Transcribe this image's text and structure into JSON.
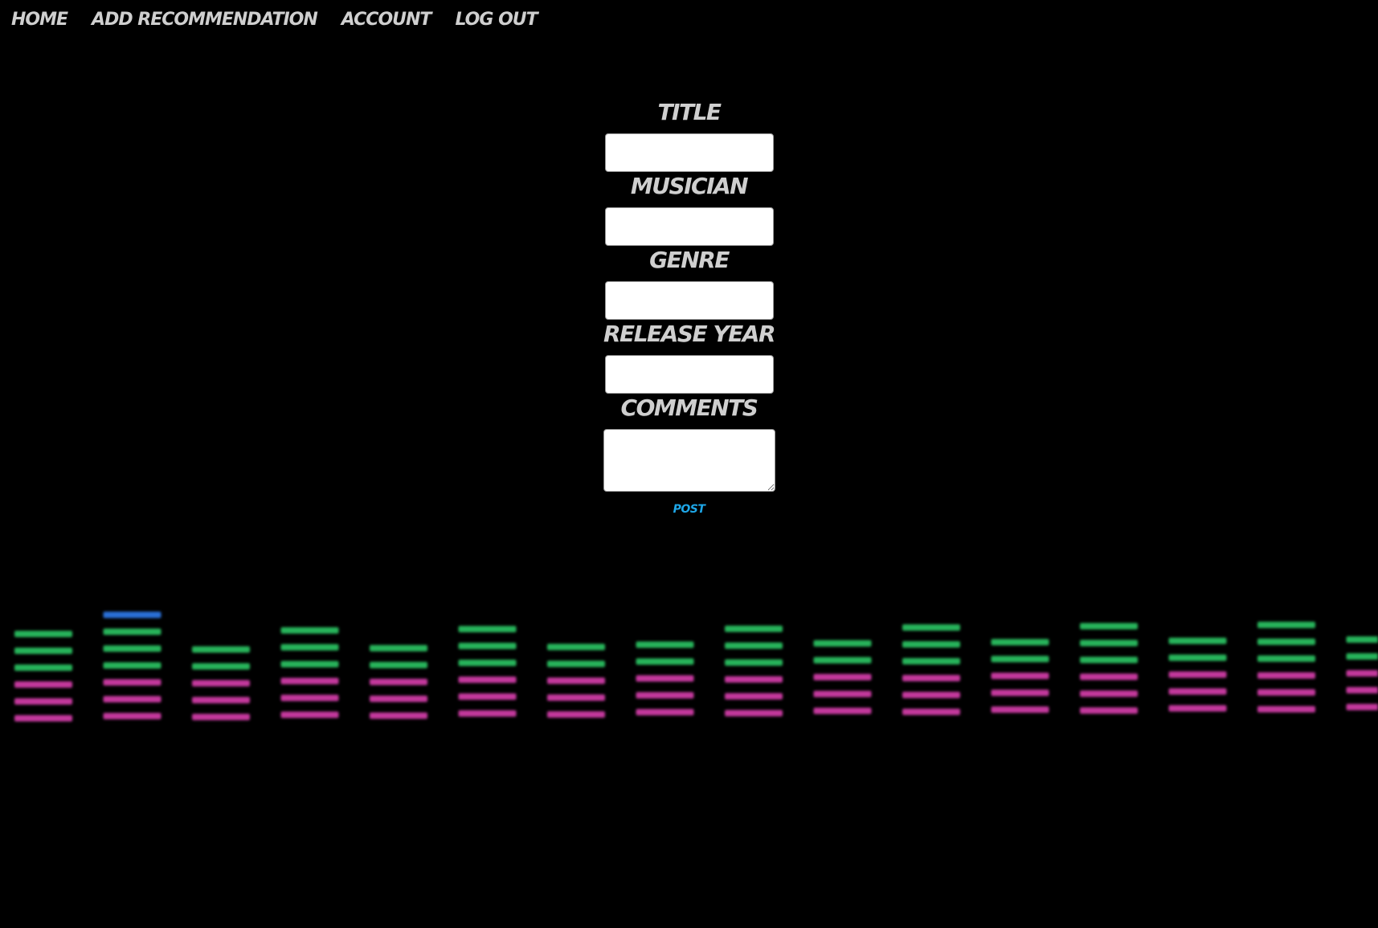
{
  "nav": {
    "home": "HOME",
    "add_recommendation": "ADD RECOMMENDATION",
    "account": "ACCOUNT",
    "logout": "LOG OUT"
  },
  "form": {
    "title_label": "TITLE",
    "musician_label": "MUSICIAN",
    "genre_label": "GENRE",
    "release_year_label": "RELEASE YEAR",
    "comments_label": "COMMENTS",
    "post_label": "POST"
  },
  "background": {
    "description_colors": {
      "green": "#27b35a",
      "magenta": "#c3389c",
      "blue": "#2a6fd6",
      "page": "#000000",
      "label": "#cfcfcf",
      "post": "#1ea7e8"
    },
    "equalizer_columns": [
      {
        "green": 3,
        "magenta": 3,
        "blue": 0
      },
      {
        "green": 3,
        "magenta": 3,
        "blue": 1
      },
      {
        "green": 2,
        "magenta": 3,
        "blue": 0
      },
      {
        "green": 3,
        "magenta": 3,
        "blue": 0
      },
      {
        "green": 2,
        "magenta": 3,
        "blue": 0
      },
      {
        "green": 3,
        "magenta": 3,
        "blue": 0
      },
      {
        "green": 2,
        "magenta": 3,
        "blue": 0
      },
      {
        "green": 2,
        "magenta": 3,
        "blue": 0
      },
      {
        "green": 3,
        "magenta": 3,
        "blue": 0
      },
      {
        "green": 2,
        "magenta": 3,
        "blue": 0
      },
      {
        "green": 3,
        "magenta": 3,
        "blue": 0
      },
      {
        "green": 2,
        "magenta": 3,
        "blue": 0
      },
      {
        "green": 3,
        "magenta": 3,
        "blue": 0
      },
      {
        "green": 2,
        "magenta": 3,
        "blue": 0
      },
      {
        "green": 3,
        "magenta": 3,
        "blue": 0
      },
      {
        "green": 2,
        "magenta": 3,
        "blue": 0
      }
    ]
  }
}
